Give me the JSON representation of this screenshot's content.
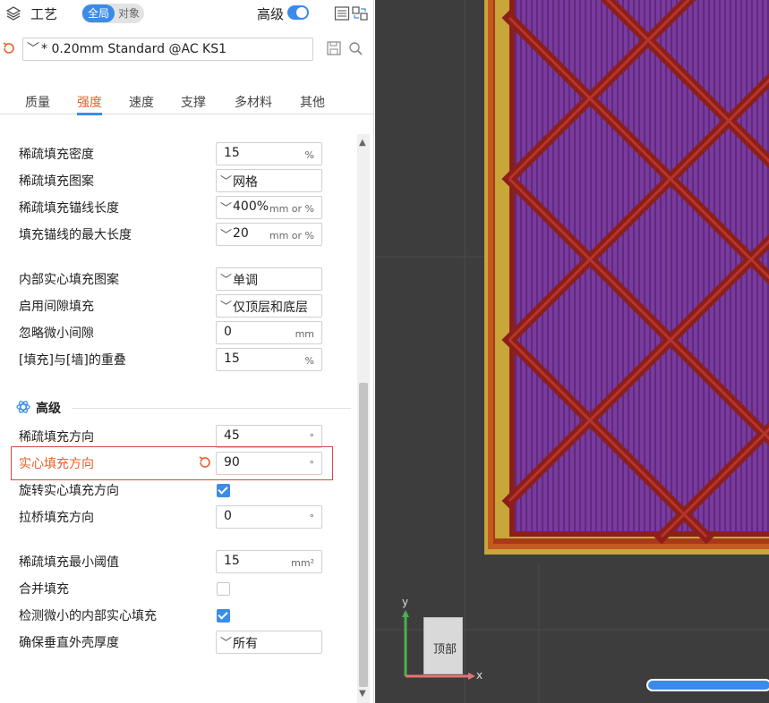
{
  "header": {
    "title": "工艺",
    "scope_global": "全局",
    "scope_object": "对象",
    "advanced_label": "高级",
    "advanced_enabled": true
  },
  "preset": {
    "value": "* 0.20mm Standard @AC KS1"
  },
  "tabs": [
    {
      "label": "质量",
      "active": false
    },
    {
      "label": "强度",
      "active": true
    },
    {
      "label": "速度",
      "active": false
    },
    {
      "label": "支撑",
      "active": false
    },
    {
      "label": "多材料",
      "active": false
    },
    {
      "label": "其他",
      "active": false
    }
  ],
  "settings": {
    "sparse_density": {
      "label": "稀疏填充密度",
      "value": "15",
      "unit": "%"
    },
    "sparse_pattern": {
      "label": "稀疏填充图案",
      "value": "网格"
    },
    "anchor_length": {
      "label": "稀疏填充锚线长度",
      "value": "400%",
      "unit": "mm or %"
    },
    "anchor_max": {
      "label": "填充锚线的最大长度",
      "value": "20",
      "unit": "mm or %"
    },
    "internal_solid_pattern": {
      "label": "内部实心填充图案",
      "value": "单调"
    },
    "gap_fill": {
      "label": "启用间隙填充",
      "value": "仅顶层和底层"
    },
    "filter_gaps": {
      "label": "忽略微小间隙",
      "value": "0",
      "unit": "mm"
    },
    "infill_wall_overlap": {
      "label": "[填充]与[墙]的重叠",
      "value": "15",
      "unit": "%"
    },
    "advanced_section": "高级",
    "sparse_direction": {
      "label": "稀疏填充方向",
      "value": "45",
      "unit": "°"
    },
    "solid_direction": {
      "label": "实心填充方向",
      "value": "90",
      "unit": "°"
    },
    "rotate_solid": {
      "label": "旋转实心填充方向",
      "checked": true
    },
    "bridge_direction": {
      "label": "拉桥填充方向",
      "value": "0",
      "unit": "°"
    },
    "sparse_threshold": {
      "label": "稀疏填充最小阈值",
      "value": "15",
      "unit": "mm²"
    },
    "combine_infill": {
      "label": "合并填充",
      "checked": false
    },
    "detect_narrow_solid": {
      "label": "检测微小的内部实心填充",
      "checked": true
    },
    "ensure_vertical_shell": {
      "label": "确保垂直外壳厚度",
      "value": "所有"
    }
  },
  "viewport": {
    "nav_cube_label": "顶部",
    "axis_x": "x",
    "axis_y": "y"
  },
  "colors": {
    "accent": "#3b8be8",
    "highlight": "#e8602c",
    "infill": "#7a3a9e",
    "wall": "#8c1f1a",
    "outer": "#c9a63a"
  }
}
